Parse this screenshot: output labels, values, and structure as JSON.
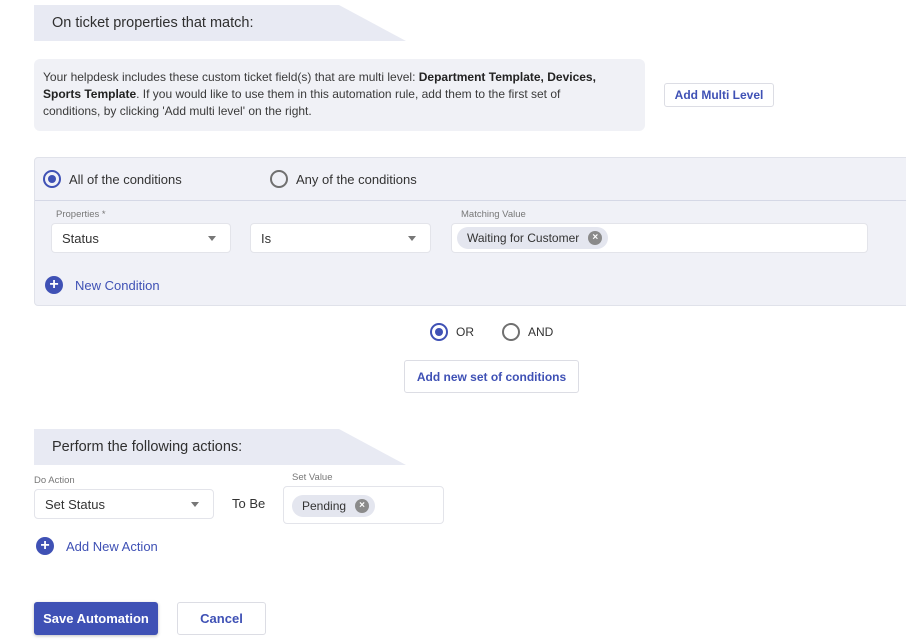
{
  "conditions_section": {
    "header": "On ticket properties that match:",
    "info": {
      "prefix": "Your helpdesk includes these custom ticket field(s) that are multi level: ",
      "fields_bold_1": "Department Template, Devices,",
      "fields_bold_2": "Sports Template",
      "suffix_1": ". If you would like to use them in this automation rule, add them to the first set of",
      "suffix_2": "conditions, by clicking 'Add multi level' on the right."
    },
    "add_multi_level_label": "Add Multi Level",
    "match_mode": {
      "options": [
        "All of the conditions",
        "Any of the conditions"
      ],
      "selected": "All of the conditions"
    },
    "condition": {
      "property_label": "Properties *",
      "property_value": "Status",
      "operator_value": "Is",
      "matching_label": "Matching Value",
      "matching_values": [
        "Waiting for Customer"
      ]
    },
    "new_condition_label": "New Condition"
  },
  "set_join": {
    "options": [
      "OR",
      "AND"
    ],
    "selected": "OR",
    "add_set_label": "Add new set of conditions"
  },
  "actions_section": {
    "header": "Perform the following actions:",
    "action_label": "Do Action",
    "action_value": "Set Status",
    "to_be_label": "To Be",
    "set_value_label": "Set Value",
    "set_values": [
      "Pending"
    ],
    "add_action_label": "Add New Action"
  },
  "footer": {
    "save_label": "Save Automation",
    "cancel_label": "Cancel"
  },
  "colors": {
    "accent": "#3f51b5",
    "panel": "#f0f1f7",
    "header_band": "#e8eaf3"
  }
}
